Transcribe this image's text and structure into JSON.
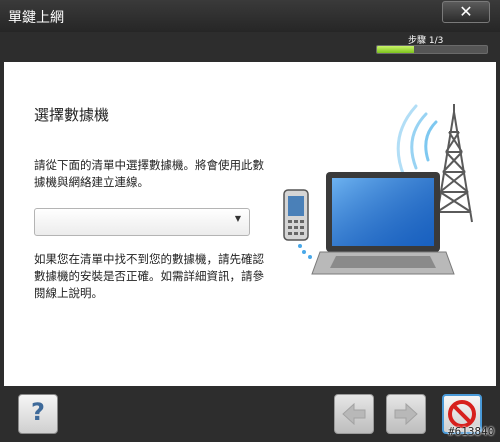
{
  "window": {
    "title": "單鍵上網",
    "close_symbol": "✕"
  },
  "progress": {
    "label": "步驟 1/3",
    "fraction": 0.3333
  },
  "main": {
    "heading": "選擇數據機",
    "instruction": "請從下面的清單中選擇數據機。將會使用此數據機與網絡建立連線。",
    "dropdown_value": "",
    "note": "如果您在清單中找不到您的數據機，請先確認數據機的安裝是否正確。如需詳細資訊，請參閱線上說明。"
  },
  "footer": {
    "help_symbol": "?"
  },
  "watermark": "#613840",
  "colors": {
    "accent_green": "#7cc21c",
    "cancel_red": "#d7201d",
    "help_blue": "#3e6a9a"
  },
  "icons": [
    "close-icon",
    "help-icon",
    "back-arrow-icon",
    "next-arrow-icon",
    "cancel-icon",
    "phone-icon",
    "laptop-icon",
    "antenna-tower-icon",
    "chevron-down-icon"
  ]
}
